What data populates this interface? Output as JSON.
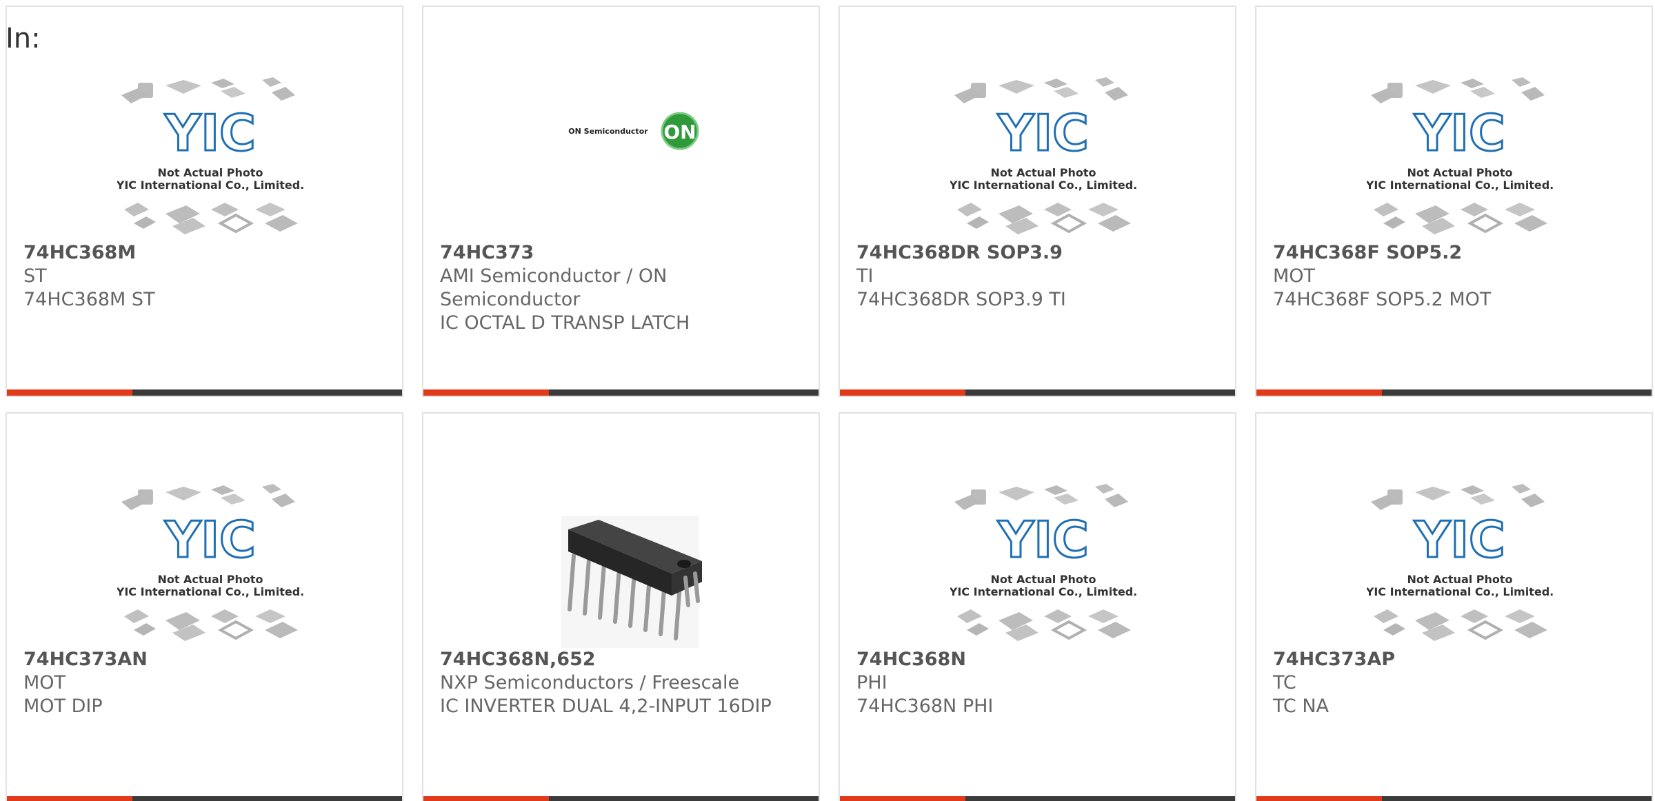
{
  "header": {
    "in_label": "In:"
  },
  "products": [
    {
      "part_number": "74HC368M",
      "manufacturer": "ST",
      "description": "74HC368M ST",
      "image": "yic-placeholder",
      "placeholder_text": [
        "Not Actual Photo",
        "YIC International Co., Limited."
      ]
    },
    {
      "part_number": "74HC373",
      "manufacturer": "AMI Semiconductor / ON Semiconductor",
      "description": "IC OCTAL D TRANSP LATCH",
      "image": "on-semiconductor-logo",
      "logo_text": "ON Semiconductor",
      "logo_badge": "ON"
    },
    {
      "part_number": "74HC368DR SOP3.9",
      "manufacturer": "TI",
      "description": "74HC368DR SOP3.9 TI",
      "image": "yic-placeholder",
      "placeholder_text": [
        "Not Actual Photo",
        "YIC International Co., Limited."
      ]
    },
    {
      "part_number": "74HC368F SOP5.2",
      "manufacturer": "MOT",
      "description": "74HC368F SOP5.2 MOT",
      "image": "yic-placeholder",
      "placeholder_text": [
        "Not Actual Photo",
        "YIC International Co., Limited."
      ]
    },
    {
      "part_number": "74HC373AN",
      "manufacturer": "MOT",
      "description": "MOT DIP",
      "image": "yic-placeholder",
      "placeholder_text": [
        "Not Actual Photo",
        "YIC International Co., Limited."
      ]
    },
    {
      "part_number": "74HC368N,652",
      "manufacturer": "NXP Semiconductors / Freescale",
      "description": "IC INVERTER DUAL 4,2-INPUT 16DIP",
      "image": "dip-chip-photo"
    },
    {
      "part_number": "74HC368N",
      "manufacturer": "PHI",
      "description": "74HC368N PHI",
      "image": "yic-placeholder",
      "placeholder_text": [
        "Not Actual Photo",
        "YIC International Co., Limited."
      ]
    },
    {
      "part_number": "74HC373AP",
      "manufacturer": "TC",
      "description": "TC NA",
      "image": "yic-placeholder",
      "placeholder_text": [
        "Not Actual Photo",
        "YIC International Co., Limited."
      ]
    }
  ],
  "colors": {
    "accent": "#e03a1a",
    "bar": "#3b3b3b",
    "yic_blue": "#1f6fb3",
    "on_green": "#2e9a3a",
    "text": "#666666"
  }
}
